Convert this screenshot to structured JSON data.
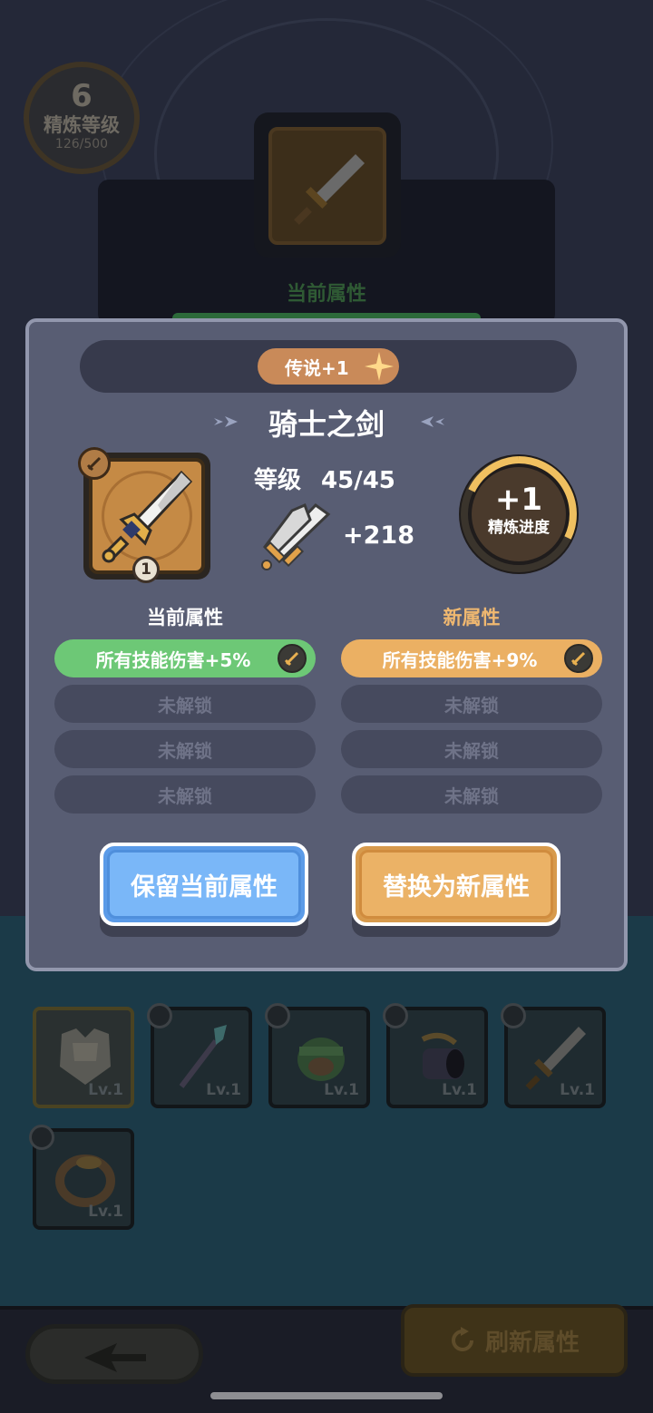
{
  "background": {
    "refine_level": {
      "value": "6",
      "label": "精炼等级",
      "exp": "126/500"
    },
    "current_attr_label": "当前属性",
    "inventory": [
      {
        "name": "armor",
        "level": "Lv.1",
        "selected": true
      },
      {
        "name": "spear",
        "level": "Lv.1"
      },
      {
        "name": "helmet",
        "level": "Lv.1"
      },
      {
        "name": "bracer",
        "level": "Lv.1"
      },
      {
        "name": "sword",
        "level": "Lv.1"
      },
      {
        "name": "ring",
        "level": "Lv.1"
      }
    ],
    "refresh_button": "刷新属性"
  },
  "modal": {
    "rarity": "传说+1",
    "item_name": "骑士之剑",
    "item_count": "1",
    "level_label": "等级",
    "level_value": "45/45",
    "attack_value": "+218",
    "refine_progress": {
      "value": "+1",
      "label": "精炼进度"
    },
    "current_title": "当前属性",
    "new_title": "新属性",
    "current_attrs": [
      "所有技能伤害+5%",
      "未解锁",
      "未解锁",
      "未解锁"
    ],
    "new_attrs": [
      "所有技能伤害+9%",
      "未解锁",
      "未解锁",
      "未解锁"
    ],
    "keep_button": "保留当前属性",
    "replace_button": "替换为新属性"
  },
  "colors": {
    "modal_bg": "#585d73",
    "current_attr": "#6dc876",
    "new_attr": "#ebb063",
    "keep_button": "#7ab7f8",
    "replace_button": "#ebb266",
    "rarity_badge": "#c98a59"
  }
}
